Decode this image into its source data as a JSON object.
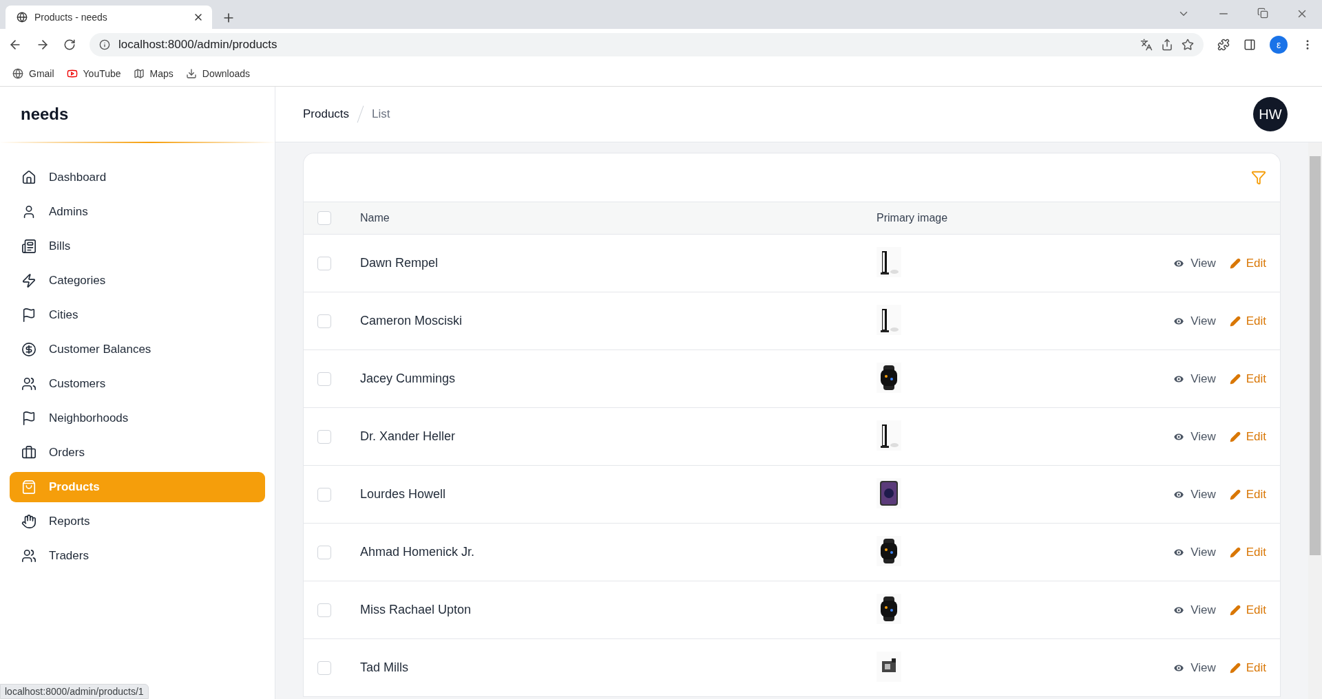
{
  "browser": {
    "tab": {
      "title": "Products - needs"
    },
    "address": "localhost:8000/admin/products",
    "profile": "ε",
    "bookmarks": [
      {
        "label": "Gmail"
      },
      {
        "label": "YouTube"
      },
      {
        "label": "Maps"
      },
      {
        "label": "Downloads"
      }
    ]
  },
  "sidebar": {
    "brand": "needs",
    "items": [
      {
        "label": "Dashboard",
        "selected": false
      },
      {
        "label": "Admins",
        "selected": false
      },
      {
        "label": "Bills",
        "selected": false
      },
      {
        "label": "Categories",
        "selected": false
      },
      {
        "label": "Cities",
        "selected": false
      },
      {
        "label": "Customer Balances",
        "selected": false
      },
      {
        "label": "Customers",
        "selected": false
      },
      {
        "label": "Neighborhoods",
        "selected": false
      },
      {
        "label": "Orders",
        "selected": false
      },
      {
        "label": "Products",
        "selected": true
      },
      {
        "label": "Reports",
        "selected": false
      },
      {
        "label": "Traders",
        "selected": false
      }
    ]
  },
  "breadcrumbs": [
    "Products",
    "List"
  ],
  "user_avatar": "HW",
  "table": {
    "select_all": {
      "checked": false
    },
    "columns": [
      "Name",
      "Primary image"
    ],
    "rows": [
      {
        "name": "Dawn Rempel",
        "checked": false,
        "view": "View",
        "edit": "Edit"
      },
      {
        "name": "Cameron Mosciski",
        "checked": false,
        "view": "View",
        "edit": "Edit"
      },
      {
        "name": "Jacey Cummings",
        "checked": false,
        "view": "View",
        "edit": "Edit"
      },
      {
        "name": "Dr. Xander Heller",
        "checked": false,
        "view": "View",
        "edit": "Edit"
      },
      {
        "name": "Lourdes Howell",
        "checked": false,
        "view": "View",
        "edit": "Edit"
      },
      {
        "name": "Ahmad Homenick Jr.",
        "checked": false,
        "view": "View",
        "edit": "Edit"
      },
      {
        "name": "Miss Rachael Upton",
        "checked": false,
        "view": "View",
        "edit": "Edit"
      },
      {
        "name": "Tad Mills",
        "checked": false,
        "view": "View",
        "edit": "Edit"
      }
    ]
  },
  "status_url": "localhost:8000/admin/products/1"
}
